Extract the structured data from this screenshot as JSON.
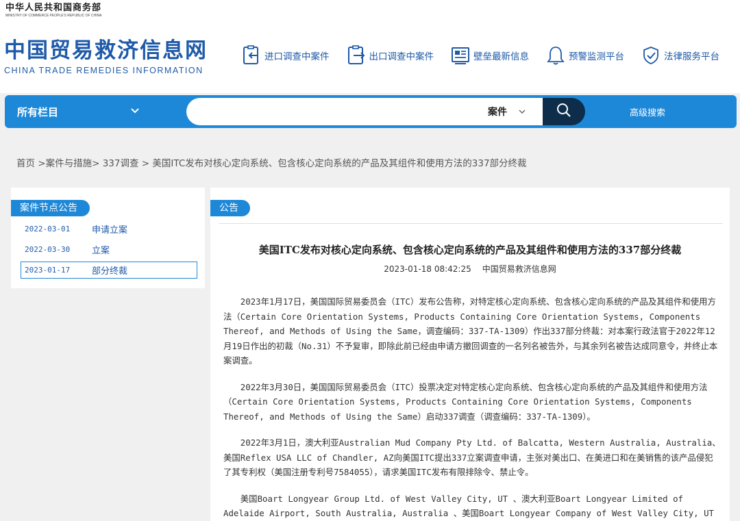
{
  "header": {
    "ministry_cn": "中华人民共和国商务部",
    "ministry_en": "MINISTRY OF COMMERCE PEOPLE'S REPUBLIC OF CHINA",
    "site_title": "中国贸易救济信息网",
    "site_subtitle": "CHINA TRADE REMEDIES INFORMATION",
    "nav": [
      {
        "label": "进口调查中案件",
        "icon": "import-case-icon"
      },
      {
        "label": "出口调查中案件",
        "icon": "export-case-icon"
      },
      {
        "label": "壁垒最新信息",
        "icon": "barrier-news-icon"
      },
      {
        "label": "预警监测平台",
        "icon": "bell-icon"
      },
      {
        "label": "法律服务平台",
        "icon": "shield-check-icon"
      }
    ]
  },
  "search": {
    "category": "所有栏目",
    "placeholder": "",
    "type": "案件",
    "advanced": "高级搜索"
  },
  "breadcrumb": {
    "home": "首页",
    "sep1": " >",
    "level1": "案件与措施",
    "sep2": "> ",
    "level2": "337调查",
    "sep3": " > ",
    "current": "美国ITC发布对核心定向系统、包含核心定向系统的产品及其组件和使用方法的337部分终裁"
  },
  "sidebar": {
    "title": "案件节点公告",
    "items": [
      {
        "date": "2022-03-01",
        "name": "申请立案"
      },
      {
        "date": "2022-03-30",
        "name": "立案"
      },
      {
        "date": "2023-01-17",
        "name": "部分终裁"
      }
    ]
  },
  "main": {
    "tag": "公告",
    "title": "美国ITC发布对核心定向系统、包含核心定向系统的产品及其组件和使用方法的337部分终裁",
    "datetime": "2023-01-18 08:42:25",
    "source": "中国贸易救济信息网",
    "paragraphs": [
      "2023年1月17日，美国国际贸易委员会（ITC）发布公告称，对特定核心定向系统、包含核心定向系统的产品及其组件和使用方法（Certain Core Orientation Systems, Products Containing Core Orientation Systems, Components Thereof, and Methods of Using the Same，调查编码：337-TA-1309）作出337部分终裁：对本案行政法官于2022年12月19日作出的初裁（No.31）不予复审，即除此前已经由申请方撤回调查的一名列名被告外，与其余列名被告达成同意令，并终止本案调查。",
      "2022年3月30日，美国国际贸易委员会（ITC）投票决定对特定核心定向系统、包含核心定向系统的产品及其组件和使用方法（Certain Core Orientation Systems, Products Containing Core Orientation Systems, Components Thereof, and Methods of Using the Same）启动337调查（调查编码：337-TA-1309）。",
      "2022年3月1日，澳大利亚Australian Mud Company Pty Ltd. of Balcatta, Western Australia, Australia、美国Reflex USA LLC of Chandler, AZ向美国ITC提出337立案调查申请，主张对美出口、在美进口和在美销售的该产品侵犯了其专利权（美国注册专利号7584055），请求美国ITC发布有限排除令、禁止令。",
      "美国Boart Longyear Group Ltd. of West Valley City, UT 、澳大利亚Boart Longyear Limited of Adelaide Airport, South Australia, Australia 、美国Boart Longyear Company of West Valley City, UT 、"
    ]
  },
  "colors": {
    "brand_blue": "#1e5aa8",
    "bar_blue": "#1e88d8",
    "search_button": "#0d2d4a"
  }
}
